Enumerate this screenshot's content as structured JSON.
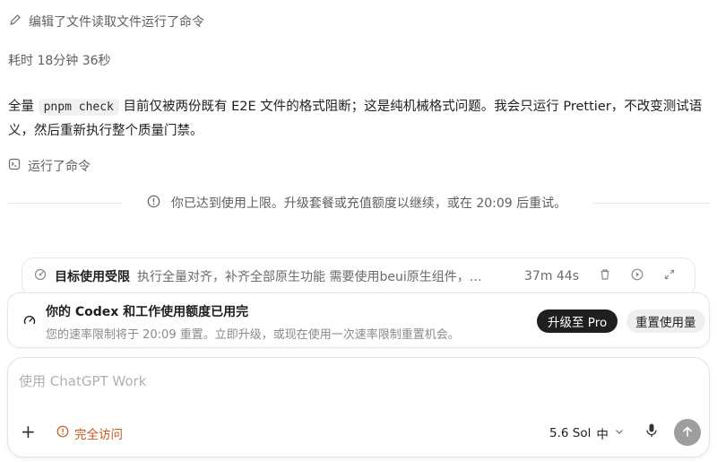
{
  "activity": {
    "edit_summary": "编辑了文件读取文件运行了命令",
    "elapsed": "耗时 18分钟 36秒",
    "message_pre": "全量 ",
    "message_code": "pnpm check",
    "message_post": " 目前仅被两份既有 E2E 文件的格式阻断；这是纯机械格式问题。我会只运行 Prettier，不改变测试语义，然后重新执行整个质量门禁。",
    "ran_command": "运行了命令",
    "limit_notice": "你已达到使用上限。升级套餐或充值额度以继续，或在 20:09 后重试。"
  },
  "task": {
    "title": "目标使用受限",
    "description": "执行全量对齐，补齐全部原生功能 需要使用beui原生组件，…",
    "time": "37m 44s"
  },
  "usage": {
    "title": "你的 Codex 和工作使用额度已用完",
    "subtitle": "您的速率限制将于 20:09 重置。立即升级，或现在使用一次速率限制重置机会。",
    "upgrade_label": "升级至 Pro",
    "reset_label": "重置使用量"
  },
  "composer": {
    "placeholder": "使用 ChatGPT Work",
    "access_label": "完全访问",
    "model_label": "5.6 Sol",
    "effort_label": "中"
  },
  "icons": {
    "edit": "pencil-icon",
    "terminal": "terminal-icon",
    "info": "info-icon",
    "task": "target-icon",
    "delete": "trash-icon",
    "play": "play-icon",
    "expand": "expand-icon",
    "gauge": "gauge-icon",
    "add": "plus-icon",
    "warning": "warning-icon",
    "chevron": "chevron-down-icon",
    "mic": "mic-icon",
    "send": "arrow-up-icon"
  },
  "colors": {
    "accent_orange": "#c2581e",
    "dark_button": "#1f1f1f",
    "send_disabled": "#9e9e9e"
  }
}
